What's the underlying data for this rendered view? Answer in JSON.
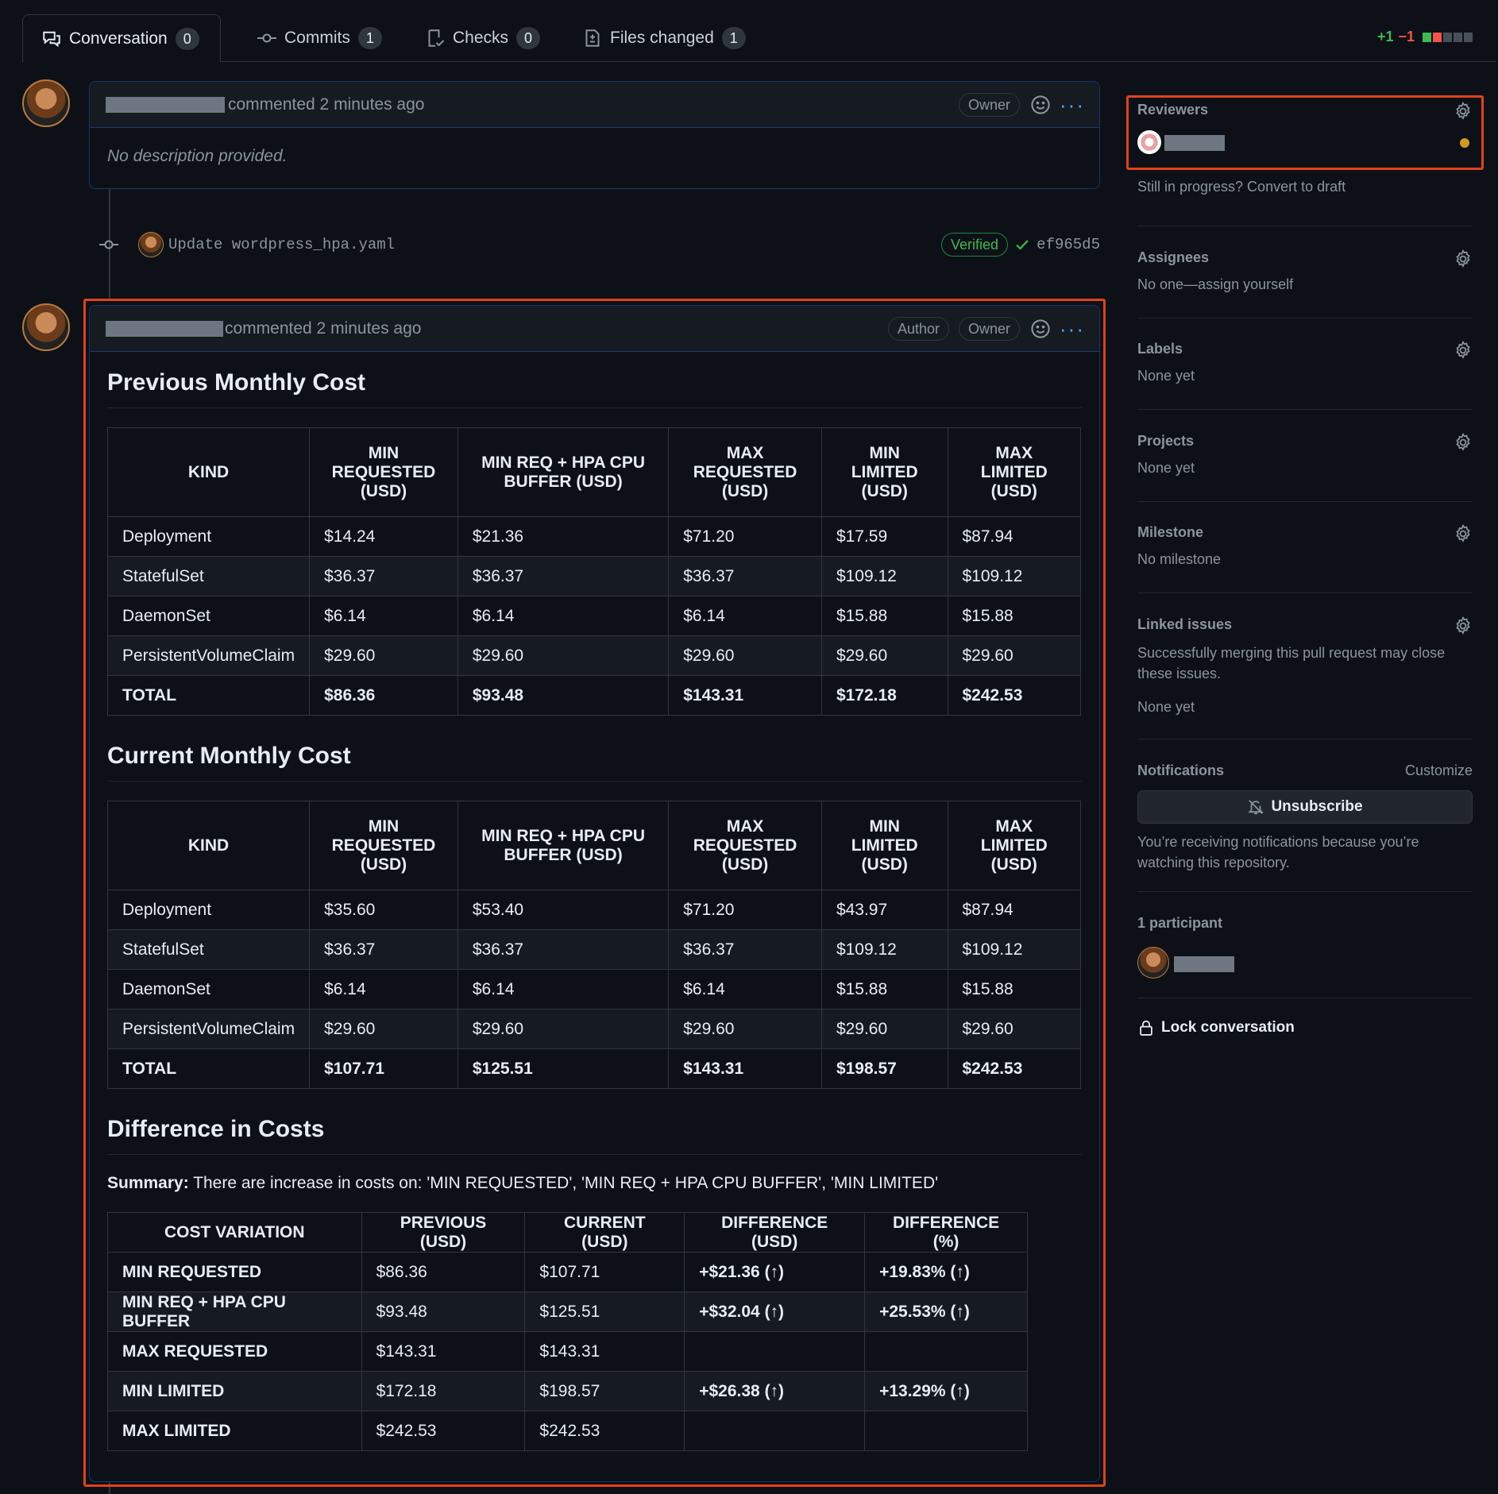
{
  "tabs": [
    {
      "label": "Conversation",
      "count": "0"
    },
    {
      "label": "Commits",
      "count": "1"
    },
    {
      "label": "Checks",
      "count": "0"
    },
    {
      "label": "Files changed",
      "count": "1"
    }
  ],
  "diffstat": {
    "added": "+1",
    "removed": "−1"
  },
  "comment1": {
    "action": "commented 2 minutes ago",
    "badges": [
      "Owner"
    ],
    "body": "No description provided."
  },
  "commit": {
    "message": "Update wordpress_hpa.yaml",
    "verified": "Verified",
    "sha": "ef965d5"
  },
  "comment2": {
    "action": "commented 2 minutes ago",
    "badges": [
      "Author",
      "Owner"
    ],
    "previous": {
      "title": "Previous Monthly Cost",
      "headers": [
        "KIND",
        "MIN REQUESTED (USD)",
        "MIN REQ + HPA CPU BUFFER (USD)",
        "MAX REQUESTED (USD)",
        "MIN LIMITED (USD)",
        "MAX LIMITED (USD)"
      ],
      "rows": [
        [
          "Deployment",
          "$14.24",
          "$21.36",
          "$71.20",
          "$17.59",
          "$87.94"
        ],
        [
          "StatefulSet",
          "$36.37",
          "$36.37",
          "$36.37",
          "$109.12",
          "$109.12"
        ],
        [
          "DaemonSet",
          "$6.14",
          "$6.14",
          "$6.14",
          "$15.88",
          "$15.88"
        ],
        [
          "PersistentVolumeClaim",
          "$29.60",
          "$29.60",
          "$29.60",
          "$29.60",
          "$29.60"
        ],
        [
          "TOTAL",
          "$86.36",
          "$93.48",
          "$143.31",
          "$172.18",
          "$242.53"
        ]
      ]
    },
    "current": {
      "title": "Current Monthly Cost",
      "headers": [
        "KIND",
        "MIN REQUESTED (USD)",
        "MIN REQ + HPA CPU BUFFER (USD)",
        "MAX REQUESTED (USD)",
        "MIN LIMITED (USD)",
        "MAX LIMITED (USD)"
      ],
      "rows": [
        [
          "Deployment",
          "$35.60",
          "$53.40",
          "$71.20",
          "$43.97",
          "$87.94"
        ],
        [
          "StatefulSet",
          "$36.37",
          "$36.37",
          "$36.37",
          "$109.12",
          "$109.12"
        ],
        [
          "DaemonSet",
          "$6.14",
          "$6.14",
          "$6.14",
          "$15.88",
          "$15.88"
        ],
        [
          "PersistentVolumeClaim",
          "$29.60",
          "$29.60",
          "$29.60",
          "$29.60",
          "$29.60"
        ],
        [
          "TOTAL",
          "$107.71",
          "$125.51",
          "$143.31",
          "$198.57",
          "$242.53"
        ]
      ]
    },
    "difference": {
      "title": "Difference in Costs",
      "summary_label": "Summary:",
      "summary_text": " There are increase in costs on: 'MIN REQUESTED', 'MIN REQ + HPA CPU BUFFER', 'MIN LIMITED'",
      "headers": [
        "COST VARIATION",
        "PREVIOUS (USD)",
        "CURRENT (USD)",
        "DIFFERENCE (USD)",
        "DIFFERENCE (%)"
      ],
      "rows": [
        [
          "MIN REQUESTED",
          "$86.36",
          "$107.71",
          "+$21.36 (↑)",
          "+19.83% (↑)"
        ],
        [
          "MIN REQ + HPA CPU BUFFER",
          "$93.48",
          "$125.51",
          "+$32.04 (↑)",
          "+25.53% (↑)"
        ],
        [
          "MAX REQUESTED",
          "$143.31",
          "$143.31",
          "",
          ""
        ],
        [
          "MIN LIMITED",
          "$172.18",
          "$198.57",
          "+$26.38 (↑)",
          "+13.29% (↑)"
        ],
        [
          "MAX LIMITED",
          "$242.53",
          "$242.53",
          "",
          ""
        ]
      ]
    }
  },
  "sidebar": {
    "reviewers": {
      "title": "Reviewers",
      "draft_link": "Still in progress? Convert to draft"
    },
    "assignees": {
      "title": "Assignees",
      "text": "No one—assign yourself"
    },
    "labels": {
      "title": "Labels",
      "text": "None yet"
    },
    "projects": {
      "title": "Projects",
      "text": "None yet"
    },
    "milestone": {
      "title": "Milestone",
      "text": "No milestone"
    },
    "linked": {
      "title": "Linked issues",
      "desc": "Successfully merging this pull request may close these issues.",
      "text": "None yet"
    },
    "notifications": {
      "title": "Notifications",
      "customize": "Customize",
      "button": "Unsubscribe",
      "desc": "You’re receiving notifications because you’re watching this repository."
    },
    "participants": {
      "title": "1 participant"
    },
    "lock": "Lock conversation"
  },
  "colors": {
    "accent": "#58a6ff",
    "highlight": "#e0421a",
    "pending": "#d29922",
    "success": "#3fb950"
  }
}
